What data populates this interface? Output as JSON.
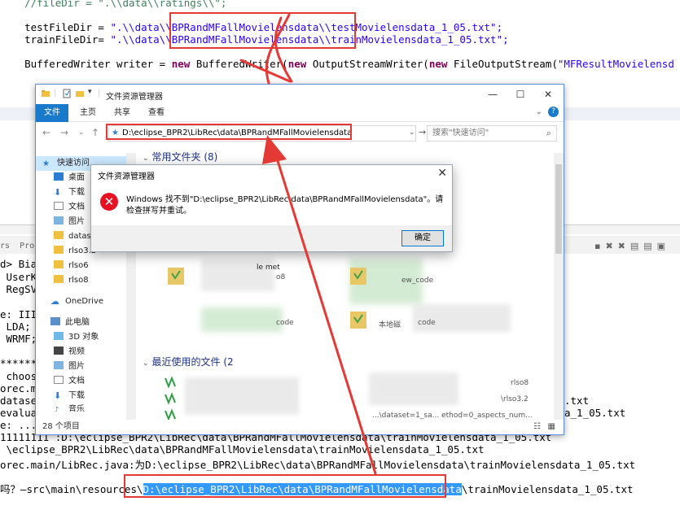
{
  "code": {
    "line0": "    //fileDir = \".\\\\data\\\\ratings\\\\\";",
    "test_prefix": "    testFileDir = ",
    "test_value": "\".\\\\data\\\\BPRandMFallMovielensdata\\\\testMovielensdata_1_05.txt\";",
    "train_prefix": "    trainFileDir= ",
    "train_value": "\".\\\\data\\\\BPRandMFallMovielensdata\\\\trainMovielensdata_1_05.txt\";",
    "writer_a": "    BufferedWriter writer = ",
    "writer_new1": "new",
    "writer_b": " BufferedWriter(",
    "writer_new2": "new",
    "writer_c": " OutputStreamWriter(",
    "writer_new3": "new",
    "writer_d": " FileOutputStream(",
    "writer_str": "\"MFResultMovielensd"
  },
  "side": {
    "lines": [
      "rs  Pro",
      "d> Biase",
      " UserKN",
      " RegSVD",
      "",
      "e: III:",
      " LDA;",
      " WRMF;",
      "",
      "********",
      " choose",
      "orec.ma",
      "dataset",
      "evaluat",
      "e: ...6",
      "11111111"
    ]
  },
  "console": {
    "line1": "11111111 :D:\\eclipse_BPR2\\LibRec\\data\\BPRandMFallMovielensdata\\trainMovielensdata_1_05.txt",
    "line2": " \\eclipse_BPR2\\LibRec\\data\\BPRandMFallMovielensdata\\trainMovielensdata_1_05.txt",
    "line3": "orec.main/LibRec.java:为D:\\eclipse_BPR2\\LibRec\\data\\BPRandMFallMovielensdata\\trainMovielensdata_1_05.txt",
    "line4_prefix": "吗？—src\\main\\resources\\",
    "line4_highlight": "D:\\eclipse_BPR2\\LibRec\\data\\BPRandMFallMovielensdata",
    "line4_suffix": "\\trainMovielensdata_1_05.txt",
    "right1": ".txt",
    "right2": "a_1_05.txt"
  },
  "explorer": {
    "title": "文件资源管理器",
    "tabs": [
      "文件",
      "主页",
      "共享",
      "查看"
    ],
    "address": "D:\\eclipse_BPR2\\LibRec\\data\\BPRandMFallMovielensdata",
    "search_placeholder": "搜索\"快速访问\"",
    "nav": {
      "quick_access": "快速访问",
      "desktop": "桌面",
      "downloads": "下载",
      "documents": "文档",
      "pictures": "图片",
      "f1": "datase",
      "f2": "rlso3.2",
      "f3": "rlso6",
      "f4": "rlso8",
      "onedrive": "OneDrive",
      "thispc": "此电脑",
      "objects3d": "3D 对象",
      "videos": "视频",
      "pictures2": "图片",
      "documents2": "文档",
      "downloads2": "下载",
      "music": "音乐"
    },
    "section_frequent": "常用文件夹 (8)",
    "section_recent": "最近使用的文件 (2",
    "tile1": "le met",
    "tile1b": "o8",
    "tile2": "ew_code",
    "tile3": "code",
    "tile4": "本地磁",
    "tile4b": "code",
    "recent1": "rlso8",
    "recent2": "\\rlso3.2",
    "recent3": "...\\dataset=1_sa... ethod=0_aspects_num...",
    "status": "28 个项目"
  },
  "dialog": {
    "title": "文件资源管理器",
    "message": "Windows 找不到\"D:\\eclipse_BPR2\\LibRec\\data\\BPRandMFallMovielensdata\"。请检查拼写并重试。",
    "ok": "确定"
  },
  "colors": {
    "annotation": "#e53935",
    "ribbon_active": "#1979ca",
    "selection": "#3399ff",
    "error_icon": "#e81123"
  }
}
